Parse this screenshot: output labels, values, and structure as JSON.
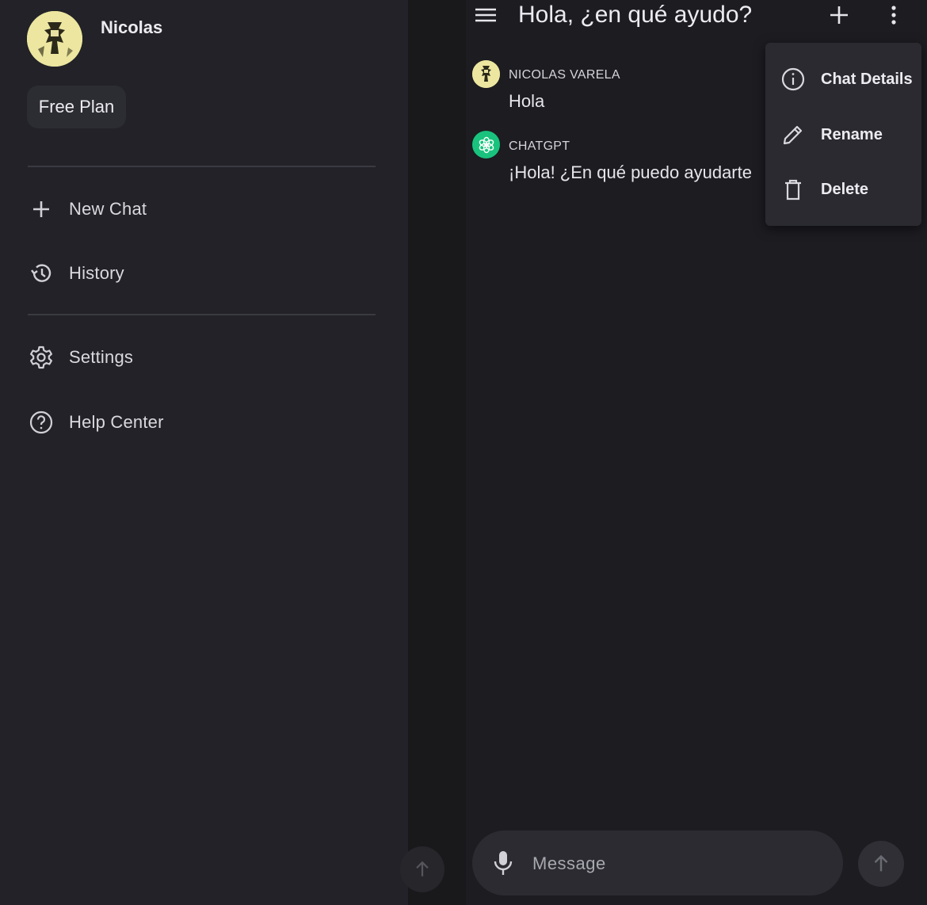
{
  "drawer": {
    "user_name": "Nicolas",
    "plan": "Free Plan",
    "nav": [
      {
        "label": "New Chat",
        "icon": "plus-icon"
      },
      {
        "label": "History",
        "icon": "history-icon"
      },
      {
        "label": "Settings",
        "icon": "gear-icon"
      },
      {
        "label": "Help Center",
        "icon": "help-circle-icon"
      }
    ]
  },
  "chat": {
    "title": "Hola, ¿en qué ayudo?",
    "messages": [
      {
        "sender": "NICOLAS VARELA",
        "text": "Hola",
        "avatar": "user-avatar"
      },
      {
        "sender": "CHATGPT",
        "text": "¡Hola! ¿En qué puedo ayudarte",
        "avatar": "chatgpt-logo-icon"
      }
    ]
  },
  "menu": {
    "items": [
      {
        "label": "Chat Details",
        "icon": "info-icon"
      },
      {
        "label": "Rename",
        "icon": "pencil-icon"
      },
      {
        "label": "Delete",
        "icon": "trash-icon"
      }
    ]
  },
  "composer": {
    "placeholder": "Message"
  },
  "colors": {
    "drawer_bg": "#222228",
    "chat_bg": "#1c1c21",
    "gpt_green": "#19c37d",
    "menu_bg": "#2a2a30"
  }
}
